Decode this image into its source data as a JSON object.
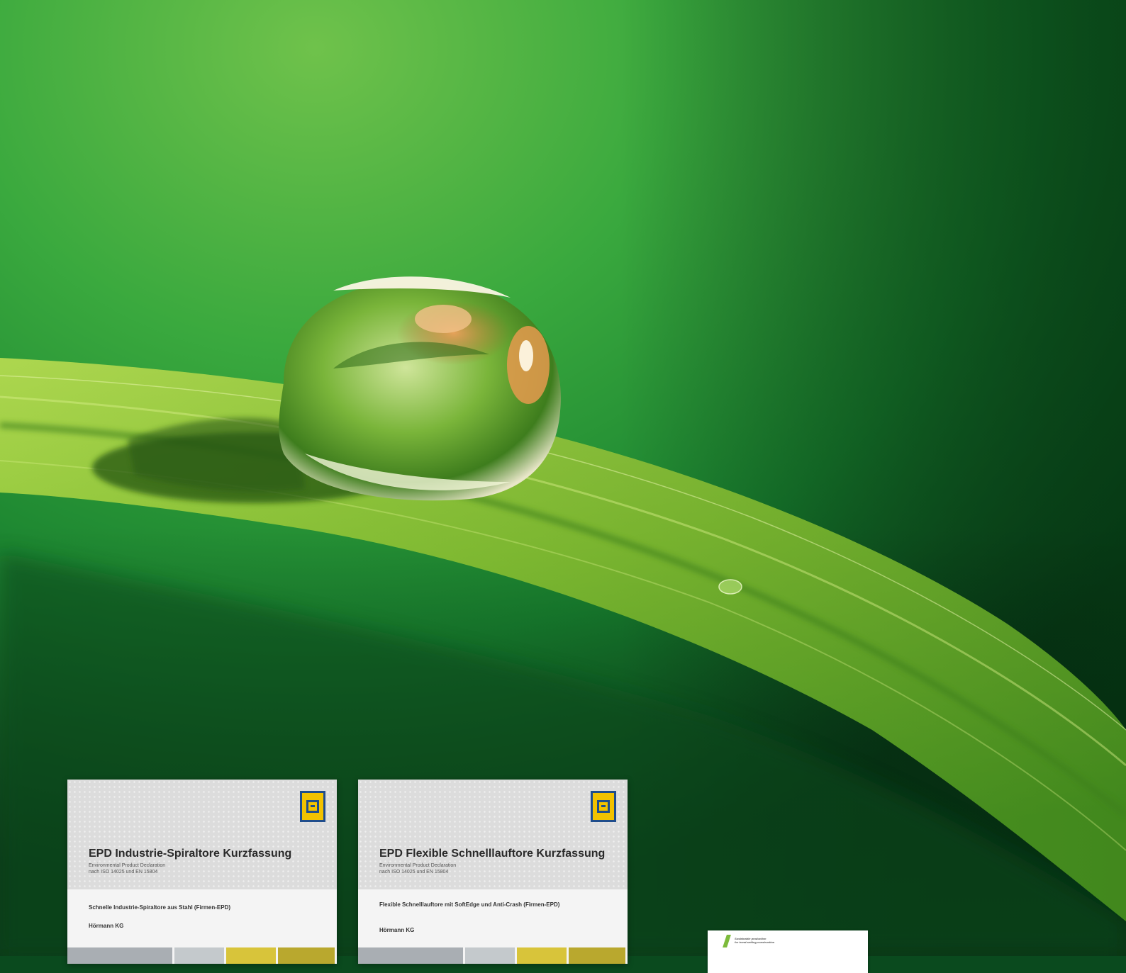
{
  "photo": {
    "subject": "water-droplet-on-grass-blade",
    "colors": {
      "background_deep": "#0b4a1f",
      "background_light": "#62b84a",
      "blade": "#8fc93a",
      "drop_highlight": "#f4e9d0",
      "drop_warm": "#c9772f"
    }
  },
  "brochures": [
    {
      "title": "EPD Industrie-Spiraltore Kurzfassung",
      "subtitle_line1": "Environmental Product Declaration",
      "subtitle_line2": "nach ISO 14025 und EN 15804",
      "description": "Schnelle Industrie-Spiraltore aus Stahl (Firmen-EPD)",
      "company": "Hörmann KG"
    },
    {
      "title": "EPD Flexible Schnelllauftore Kurzfassung",
      "subtitle_line1": "Environmental Product Declaration",
      "subtitle_line2": "nach ISO 14025 und EN 15804",
      "description": "Flexible Schnelllauftore mit SoftEdge und Anti-Crash (Firmen-EPD)",
      "company": "Hörmann KG"
    }
  ],
  "small_card": {
    "line1": "Sustainable production",
    "line2": "for trend-setting construction"
  },
  "logo": {
    "fill": "#f2c200",
    "border": "#1f4d8c",
    "icon": "hoermann-logo-icon"
  }
}
